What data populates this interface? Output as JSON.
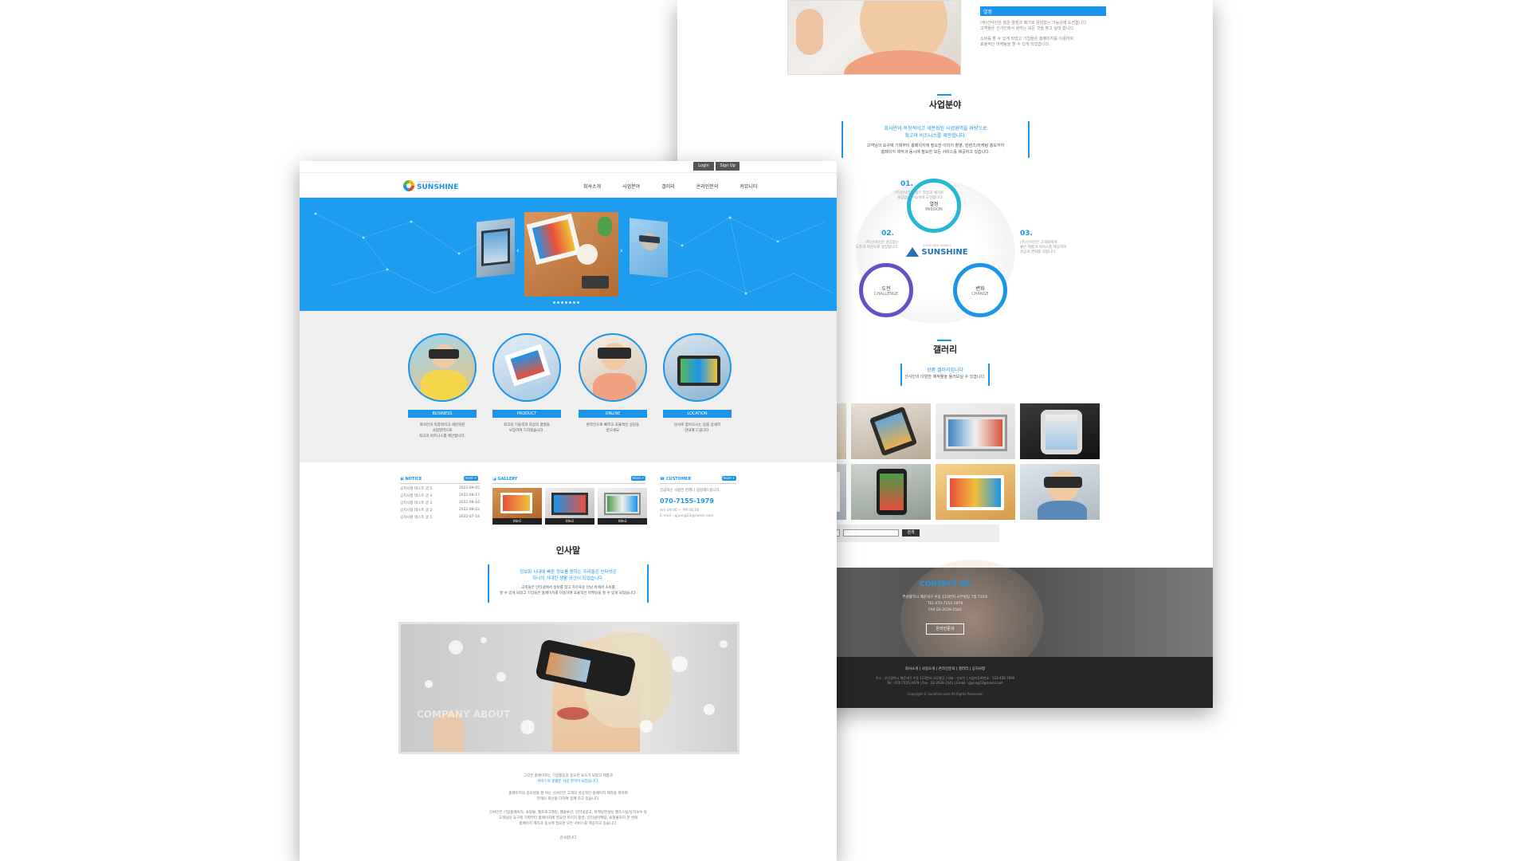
{
  "back": {
    "top_tag": "열정",
    "top_text": [
      "(주)선샤인은 젊은 열정과 패기로 끊임없는 가능성에 도전합니다.",
      "고객들은 선샤인에서 원하는 모든 것을 찾고 싶어 합니다."
    ],
    "top_text2": [
      "소비를 할 수 있게 되었고 기업들은 홈페이지를 이용하여",
      "효율적인 마케팅을 할 수 있게 되었습니다."
    ],
    "biz_title": "사업분야",
    "biz_blue": [
      "회사만의 독창적이고 세분화된 사업영역을 바탕으로",
      "최고의 비즈니스를 제안합니다."
    ],
    "biz_gray": [
      "고객님의 요구에 기획부터 홈페이지에 필요한 이미지 촬영, 컨텐츠/마케팅 홍보까지",
      "홈페이지 제작과 동시에 필요한 모든 서비스를 제공하고 있습니다."
    ],
    "logo_sub": "SOLVE WEB AGENCY",
    "logo_name": "SUNSHINE",
    "values": [
      {
        "num": "01.",
        "ko": "열정",
        "en": "PASSION",
        "text": [
          "(주)선샤인은 젊은 열정과 패기로",
          "끊임없는 가능성에 도전합니다."
        ]
      },
      {
        "num": "02.",
        "ko": "도전",
        "en": "CHALLENGE",
        "text": [
          "(주)선샤인은 끊임없는",
          "도전과 혁신으로 성장합니다."
        ]
      },
      {
        "num": "03.",
        "ko": "변화",
        "en": "CHANGE",
        "text": [
          "(주)선샤인은 고객들에게",
          "좋은 제품과 서비스를 제공하여",
          "성공과 변화를 꾀합니다."
        ]
      }
    ],
    "gallery_title": "갤러리",
    "gallery_blue": "상품 갤러리입니다",
    "gallery_gray": "선샤인의 다양한 제작물을 둘러보실 수 있습니다.",
    "search_select": "제목",
    "search_button": "검색",
    "contact_title": "CONTACT US",
    "contact_lines": [
      "부산광역시 해운대구 우동 123번지 사무빌딩 7층 710호",
      "TEL 070-7155-1979",
      "FAX 02-2039-1542"
    ],
    "contact_button": "온라인문의",
    "footer_menu": [
      "회사소개",
      "사업소개",
      "온라인문의",
      "갤러리",
      "공지사항"
    ],
    "footer_info": [
      "주소 : 부산광역시 해운대구 우동 123번지 사무빌딩 | 대표 : 선샤인 | 사업자등록번호 : 123-456-7890",
      "Tel : 070-7155-1979 | Fax : 02-2039-1542 | Email : gjyong23@naver.com"
    ],
    "copyright": "Copyright © Sunshine.com All Rights Reserved."
  },
  "front": {
    "login": "Login",
    "signup": "Sign Up",
    "logo_sub": "SOLVE WEB AGENCY",
    "logo_name": "SUNSHINE",
    "menu": [
      "회사소개",
      "사업분야",
      "갤러리",
      "온라인문의",
      "커뮤니티"
    ],
    "services": [
      {
        "label": "BUSINESS",
        "desc": [
          "회사만의 독창적이고 세분화된",
          "사업영역으로",
          "최고의 비즈니스를 제안합니다."
        ]
      },
      {
        "label": "PRODUCT",
        "desc": [
          "최고의 기술력과 최상의 품질을",
          "보장하여 드리겠습니다."
        ]
      },
      {
        "label": "ONLINE",
        "desc": [
          "온라인으로 빠르고 효율적인 상담을",
          "받으세요"
        ]
      },
      {
        "label": "LOCATION",
        "desc": [
          "당사로 찾아오시는 길을 상세히",
          "안내해 드립니다."
        ]
      }
    ],
    "notice": {
      "title": "NOTICE",
      "more": "more +",
      "rows": [
        {
          "t": "공지사항 테스트 글 5",
          "d": "2022-09-05"
        },
        {
          "t": "공지사항 테스트 글 4",
          "d": "2022-08-17"
        },
        {
          "t": "공지사항 테스트 글 3",
          "d": "2022-08-16"
        },
        {
          "t": "공지사항 테스트 글 2",
          "d": "2022-08-02"
        },
        {
          "t": "공지사항 테스트 글 1",
          "d": "2022-07-18"
        }
      ]
    },
    "gallery": {
      "title": "GALLERY",
      "more": "more +",
      "items": [
        "title1",
        "title2",
        "title3"
      ]
    },
    "customer": {
      "title": "CUSTOMER",
      "more": "more +",
      "intro": "궁금하신 사항은 언제나 상담해드립니다.",
      "phone": "070-7155-1979",
      "hours": "Am 09:00 ~ PM 06:00",
      "email": "E-mail : gjyong23@naver.com"
    },
    "greeting_title": "인사말",
    "greeting_blue": [
      "정보화 시대에 빠른 정보를 원하는 우리들은 인터넷은",
      "하나의 거대한 생활 공간이 되었습니다."
    ],
    "greeting_gray": [
      "고객들은 인터넷에서 정보를 찾고 자유로운 만남 속에서 소비를",
      "할 수 있게 되었고 기업들은 홈페이지를 이용하여 효율적인 마케팅을 할 수 있게 되었습니다."
    ],
    "about_caption": "COMPANY ABOUT",
    "about_p1": [
      "그것은 홈페이지는 기업활동의 중요한 요소가 되었고 제품과",
      "서비스의 원활한 사업 영역이 되었습니다."
    ],
    "about_p2": [
      "홈페이지의 중요성을 잘 아는 선샤인은 고객의 성공적인 홈페이지 제작을 위하여",
      "언제나 최선을 다하여 함께 하고 있습니다."
    ],
    "about_p3": [
      "선샤인은 기업홈페이지, 쇼핑몰, 웹프로그래밍, 웹솔루션, 인터넷광고, 마케팅컨설팅 웹호스팅/유지보수 등",
      "고객님의 요구에 기획부터 홈페이지에 필요한 이미지 촬영, 인터넷마케팅, 쇼핑몰까지 한 번에",
      "홈페이지 제작과 동시에 필요한 모든 서비스를 제공하고 있습니다."
    ],
    "about_sign": "감사합니다"
  },
  "colors": {
    "accent": "#1a95ea",
    "hero": "#1e9cf0",
    "dark": "#262626"
  }
}
